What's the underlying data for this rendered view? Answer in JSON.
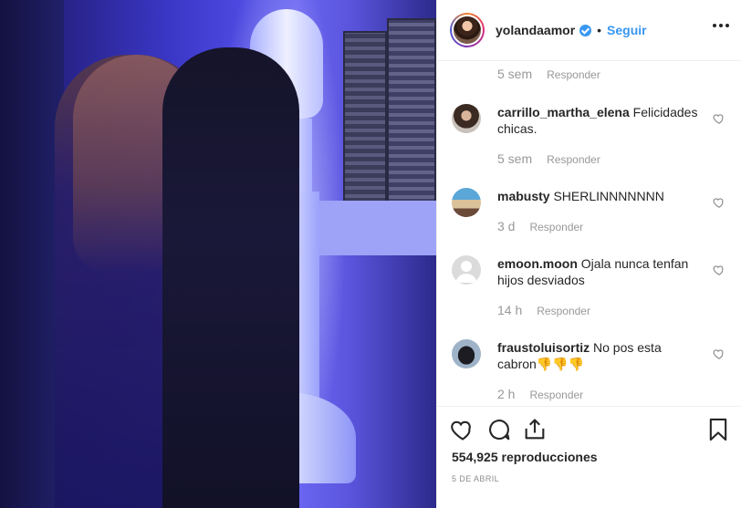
{
  "post": {
    "username": "yolandaamor",
    "follow_label": "Seguir",
    "dot": "•"
  },
  "comments": {
    "first_meta": {
      "time": "5 sem",
      "reply": "Responder"
    },
    "items": [
      {
        "user": "carrillo_martha_elena",
        "text": "Felicidades chicas.",
        "time": "5 sem",
        "reply": "Responder",
        "avatar": "woman-photo"
      },
      {
        "user": "mabusty",
        "text": "SHERLINNNNNNN",
        "time": "3 d",
        "reply": "Responder",
        "avatar": "group-photo"
      },
      {
        "user": "emoon.moon",
        "text": "Ojala nunca tenfan hijos desviados",
        "time": "14 h",
        "reply": "Responder",
        "avatar": "default-avatar"
      },
      {
        "user": "fraustoluisortiz",
        "text": "No pos esta cabron",
        "emoji": "👎👎👎",
        "time": "2 h",
        "reply": "Responder",
        "avatar": "horse-photo"
      }
    ]
  },
  "footer": {
    "views": "554,925 reproducciones",
    "date": "5 DE ABRIL"
  },
  "colors": {
    "accent": "#3897f0",
    "text": "#262626",
    "muted": "#8e8e8e",
    "border": "#efefef"
  }
}
